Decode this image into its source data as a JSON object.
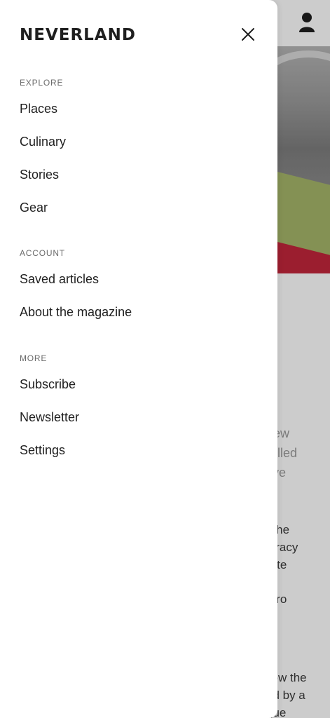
{
  "drawer": {
    "brand": "NEVERLAND",
    "close_icon": "close-icon",
    "sections": [
      {
        "label": "EXPLORE",
        "items": [
          "Places",
          "Culinary",
          "Stories",
          "Gear"
        ]
      },
      {
        "label": "ACCOUNT",
        "items": [
          "Saved articles",
          "About the magazine"
        ]
      },
      {
        "label": "MORE",
        "items": [
          "Subscribe",
          "Newsletter",
          "Settings"
        ]
      }
    ]
  },
  "background": {
    "avatar_icon": "user-icon",
    "intro_fragments": [
      "new",
      "rolled",
      "tive"
    ],
    "body_fragments": [
      "f the",
      "piracy",
      "rate",
      "etro",
      "o",
      "llow the",
      "ed by a",
      "que"
    ]
  },
  "colors": {
    "drawer_bg": "#ffffff",
    "text_primary": "#1f1f1f",
    "text_secondary": "#6b6b6b",
    "train_green": "#a6b66a",
    "train_red": "#c2263b"
  }
}
